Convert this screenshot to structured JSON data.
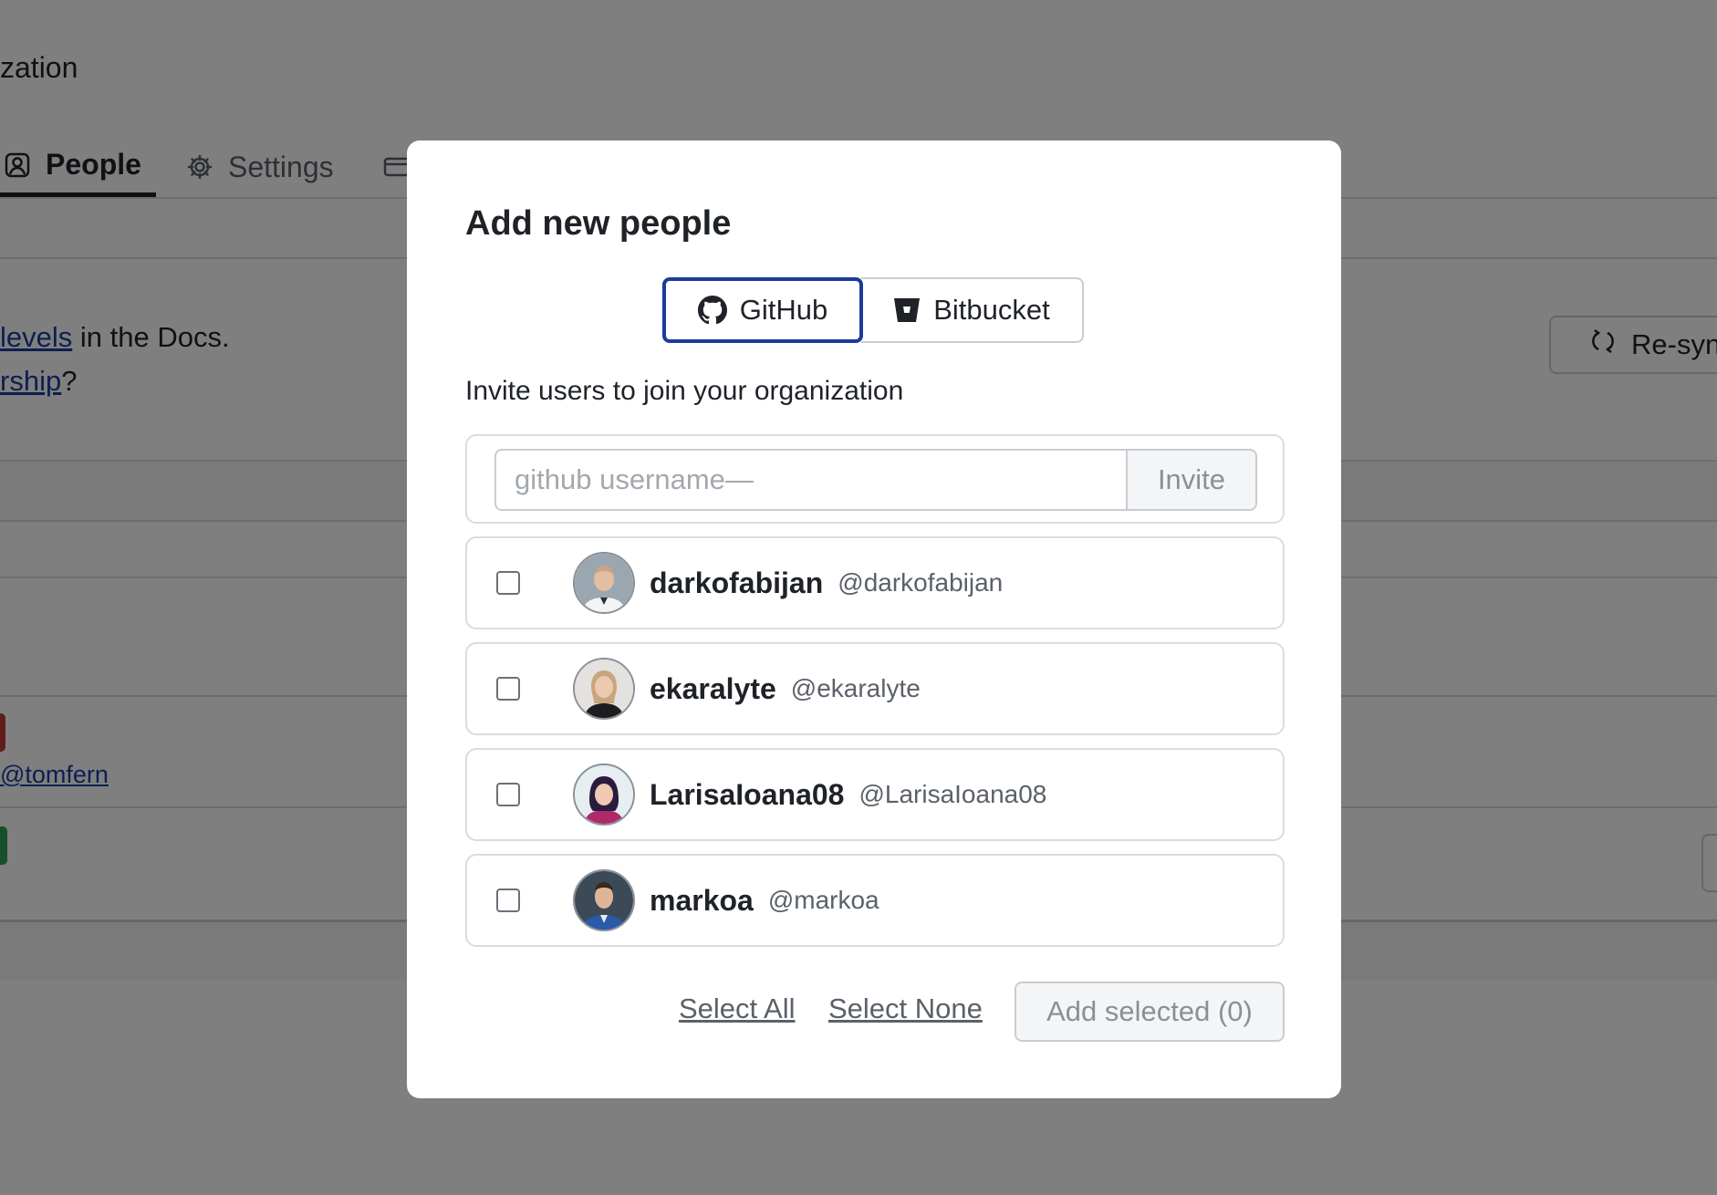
{
  "background": {
    "title_fragment": "zation",
    "tabs": [
      {
        "label": "People",
        "icon": "person-badge-icon",
        "active": true
      },
      {
        "label": "Settings",
        "icon": "gear-icon",
        "active": false
      },
      {
        "label": "",
        "icon": "card-icon",
        "active": false
      }
    ],
    "docs_link": "levels",
    "docs_text": " in the Docs.",
    "ownership_link": "rship",
    "ownership_text": "?",
    "resync_label": "Re-syn",
    "user_link": "@tomfern"
  },
  "modal": {
    "title": "Add new people",
    "providers": [
      {
        "label": "GitHub",
        "icon": "github-icon",
        "selected": true
      },
      {
        "label": "Bitbucket",
        "icon": "bitbucket-icon",
        "selected": false
      }
    ],
    "invite_label": "Invite users to join your organization",
    "invite_placeholder": "github username—",
    "invite_button": "Invite",
    "users": [
      {
        "name": "darkofabijan",
        "handle": "@darkofabijan",
        "checked": false
      },
      {
        "name": "ekaralyte",
        "handle": "@ekaralyte",
        "checked": false
      },
      {
        "name": "LarisaIoana08",
        "handle": "@LarisaIoana08",
        "checked": false
      },
      {
        "name": "markoa",
        "handle": "@markoa",
        "checked": false
      }
    ],
    "select_all": "Select All",
    "select_none": "Select None",
    "add_selected": "Add selected (0)"
  },
  "colors": {
    "overlay": "#808080",
    "accent_border": "#1c3a99",
    "link": "#1a3fa0",
    "badge_red": "#c23b34",
    "badge_green": "#2e9c58"
  }
}
